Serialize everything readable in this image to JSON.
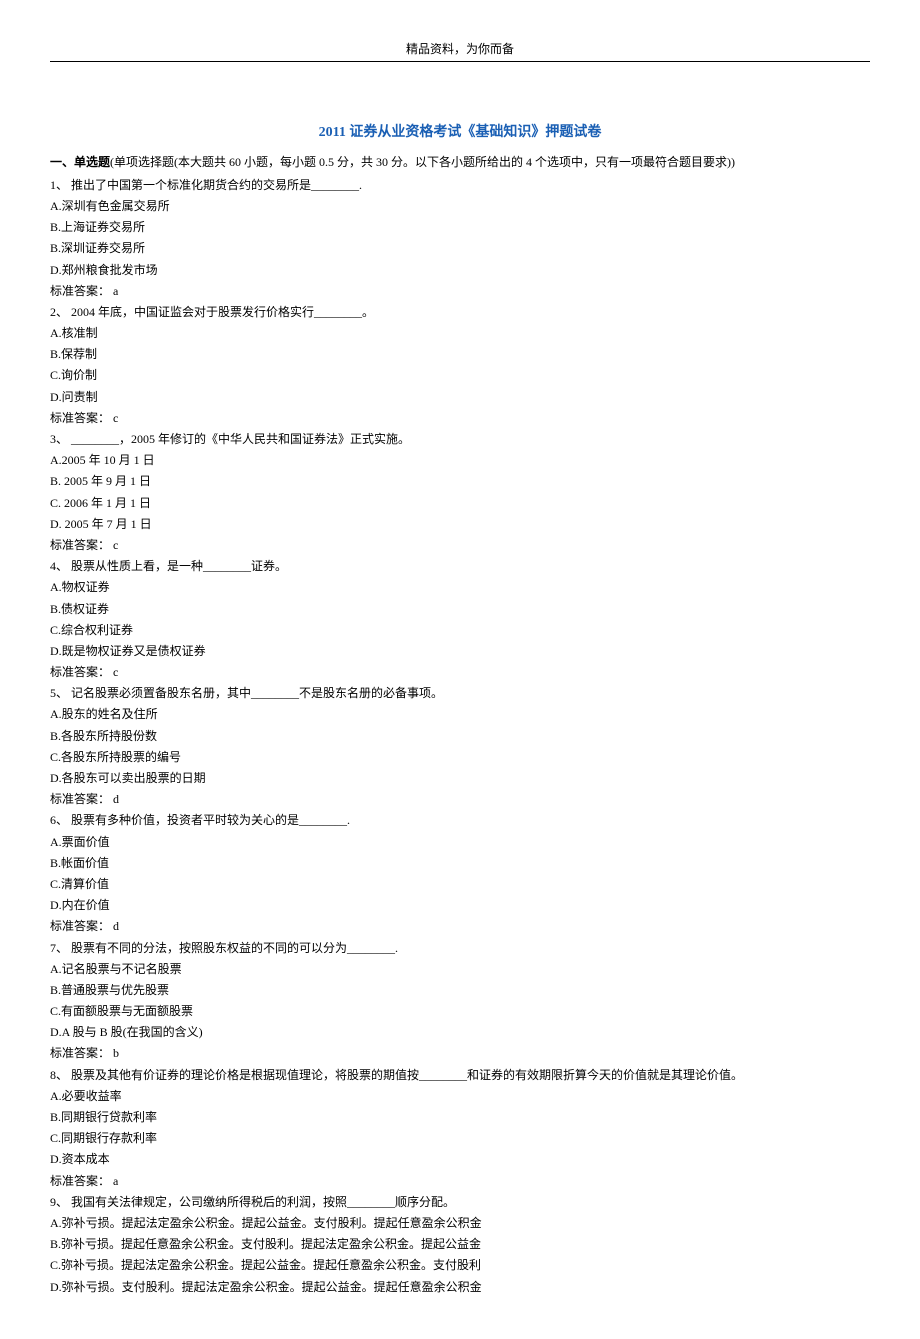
{
  "header_text": "精品资料，为你而备",
  "title": "2011 证券从业资格考试《基础知识》押题试卷",
  "section": {
    "label": "一、单选题",
    "description": "(单项选择题(本大题共 60 小题，每小题 0.5 分，共 30 分。以下各小题所给出的 4 个选项中，只有一项最符合题目要求))"
  },
  "questions": [
    {
      "number": "1、",
      "text": "推出了中国第一个标准化期货合约的交易所是________.",
      "options": [
        "A.深圳有色金属交易所",
        "B.上海证券交易所",
        "B.深圳证券交易所",
        "D.郑州粮食批发市场"
      ],
      "answer": "标准答案：  a"
    },
    {
      "number": "2、",
      "text": "2004 年底，中国证监会对于股票发行价格实行________。",
      "options": [
        "A.核准制",
        "B.保荐制",
        "C.询价制",
        "D.问责制"
      ],
      "answer": "标准答案：  c"
    },
    {
      "number": "3、",
      "text": "________，2005 年修订的《中华人民共和国证券法》正式实施。",
      "options": [
        "A.2005 年 10 月 1 日",
        "B. 2005 年 9 月 1 日",
        "C. 2006 年 1 月 1 日",
        "D. 2005 年 7 月 1 日"
      ],
      "answer": "标准答案：  c"
    },
    {
      "number": "4、",
      "text": "股票从性质上看，是一种________证券。",
      "options": [
        "A.物权证券",
        "B.债权证券",
        "C.综合权利证券",
        "D.既是物权证券又是债权证券"
      ],
      "answer": "标准答案：  c"
    },
    {
      "number": "5、",
      "text": "记名股票必须置备股东名册，其中________不是股东名册的必备事项。",
      "options": [
        "A.股东的姓名及住所",
        "B.各股东所持股份数",
        "C.各股东所持股票的编号",
        "D.各股东可以卖出股票的日期"
      ],
      "answer": "标准答案：  d"
    },
    {
      "number": "6、",
      "text": "股票有多种价值，投资者平时较为关心的是________.",
      "options": [
        "A.票面价值",
        "B.帐面价值",
        "C.清算价值",
        "D.内在价值"
      ],
      "answer": "标准答案：  d"
    },
    {
      "number": "7、",
      "text": "股票有不同的分法，按照股东权益的不同的可以分为________.",
      "options": [
        "A.记名股票与不记名股票",
        "B.普通股票与优先股票",
        "C.有面额股票与无面额股票",
        "D.A 股与 B 股(在我国的含义)"
      ],
      "answer": "标准答案：  b"
    },
    {
      "number": "8、",
      "text": "股票及其他有价证券的理论价格是根据现值理论，将股票的期值按________和证券的有效期限折算今天的价值就是其理论价值。",
      "options": [
        "A.必要收益率",
        "B.同期银行贷款利率",
        "C.同期银行存款利率",
        "D.资本成本"
      ],
      "answer": "标准答案：  a"
    },
    {
      "number": "9、",
      "text": "我国有关法律规定，公司缴纳所得税后的利润，按照________顺序分配。",
      "options": [
        "A.弥补亏损。提起法定盈余公积金。提起公益金。支付股利。提起任意盈余公积金",
        "B.弥补亏损。提起任意盈余公积金。支付股利。提起法定盈余公积金。提起公益金",
        "C.弥补亏损。提起法定盈余公积金。提起公益金。提起任意盈余公积金。支付股利",
        "D.弥补亏损。支付股利。提起法定盈余公积金。提起公益金。提起任意盈余公积金"
      ],
      "answer": ""
    }
  ]
}
